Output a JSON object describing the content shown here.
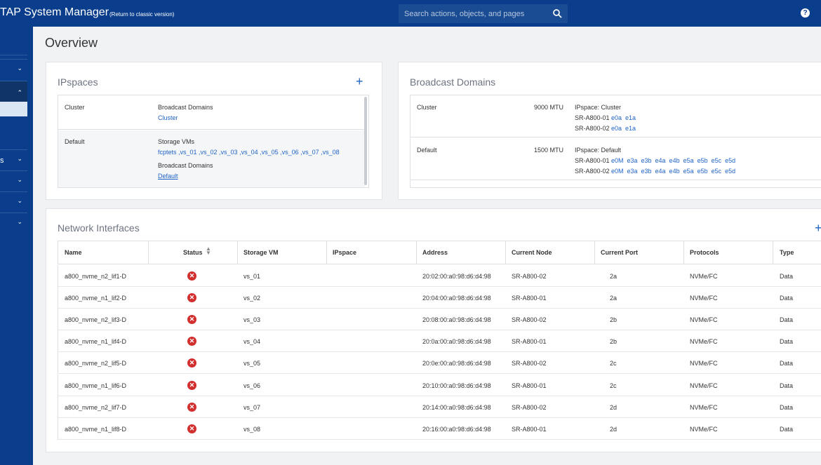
{
  "header": {
    "app_title": "TAP System Manager",
    "classic_link": "(Return to classic version)",
    "search_placeholder": "Search actions, objects, and pages",
    "help_label": "?"
  },
  "sidebar": {
    "partial_label": "s"
  },
  "page": {
    "title": "Overview"
  },
  "ipspaces": {
    "title": "IPspaces",
    "rows": [
      {
        "name": "Cluster",
        "bd_label": "Broadcast Domains",
        "bd_value": "Cluster"
      },
      {
        "name": "Default",
        "svm_label": "Storage VMs",
        "svm_value": "fcptets ,vs_01 ,vs_02 ,vs_03 ,vs_04 ,vs_05 ,vs_06 ,vs_07 ,vs_08",
        "bd_label": "Broadcast Domains",
        "bd_value": "Default"
      }
    ]
  },
  "broadcast": {
    "title": "Broadcast Domains",
    "rows": [
      {
        "name": "Cluster",
        "mtu": "9000 MTU",
        "ipspace": "IPspace: Cluster",
        "nodes": [
          {
            "node": "SR-A800-01",
            "ports": "e0a  e1a"
          },
          {
            "node": "SR-A800-02",
            "ports": "e0a  e1a"
          }
        ]
      },
      {
        "name": "Default",
        "mtu": "1500 MTU",
        "ipspace": "IPspace: Default",
        "nodes": [
          {
            "node": "SR-A800-01",
            "ports": "e0M  e3a  e3b  e4a  e4b  e5a  e5b  e5c  e5d"
          },
          {
            "node": "SR-A800-02",
            "ports": "e0M  e3a  e3b  e4a  e4b  e5a  e5b  e5c  e5d"
          }
        ]
      }
    ]
  },
  "network": {
    "title": "Network Interfaces",
    "columns": [
      "Name",
      "Status",
      "Storage VM",
      "IPspace",
      "Address",
      "Current Node",
      "Current Port",
      "Protocols",
      "Type"
    ],
    "sort_icon": "sort-icon",
    "rows": [
      {
        "name": "a800_nvme_n2_lif1-D",
        "svm": "vs_01",
        "address": "20:02:00:a0:98:d6:d4:98",
        "node": "SR-A800-02",
        "port": "2a",
        "protocols": "NVMe/FC",
        "type": "Data"
      },
      {
        "name": "a800_nvme_n1_lif2-D",
        "svm": "vs_02",
        "address": "20:04:00:a0:98:d6:d4:98",
        "node": "SR-A800-01",
        "port": "2a",
        "protocols": "NVMe/FC",
        "type": "Data"
      },
      {
        "name": "a800_nvme_n2_lif3-D",
        "svm": "vs_03",
        "address": "20:08:00:a0:98:d6:d4:98",
        "node": "SR-A800-02",
        "port": "2b",
        "protocols": "NVMe/FC",
        "type": "Data"
      },
      {
        "name": "a800_nvme_n1_lif4-D",
        "svm": "vs_04",
        "address": "20:0a:00:a0:98:d6:d4:98",
        "node": "SR-A800-01",
        "port": "2b",
        "protocols": "NVMe/FC",
        "type": "Data"
      },
      {
        "name": "a800_nvme_n2_lif5-D",
        "svm": "vs_05",
        "address": "20:0e:00:a0:98:d6:d4:98",
        "node": "SR-A800-02",
        "port": "2c",
        "protocols": "NVMe/FC",
        "type": "Data"
      },
      {
        "name": "a800_nvme_n1_lif6-D",
        "svm": "vs_06",
        "address": "20:10:00:a0:98:d6:d4:98",
        "node": "SR-A800-01",
        "port": "2c",
        "protocols": "NVMe/FC",
        "type": "Data"
      },
      {
        "name": "a800_nvme_n2_lif7-D",
        "svm": "vs_07",
        "address": "20:14:00:a0:98:d6:d4:98",
        "node": "SR-A800-02",
        "port": "2d",
        "protocols": "NVMe/FC",
        "type": "Data"
      },
      {
        "name": "a800_nvme_n1_lif8-D",
        "svm": "vs_08",
        "address": "20:16:00:a0:98:d6:d4:98",
        "node": "SR-A800-01",
        "port": "2d",
        "protocols": "NVMe/FC",
        "type": "Data"
      }
    ]
  },
  "colors": {
    "nav": "#0a3e8c",
    "link": "#1f63c6",
    "error": "#d22f2f"
  }
}
